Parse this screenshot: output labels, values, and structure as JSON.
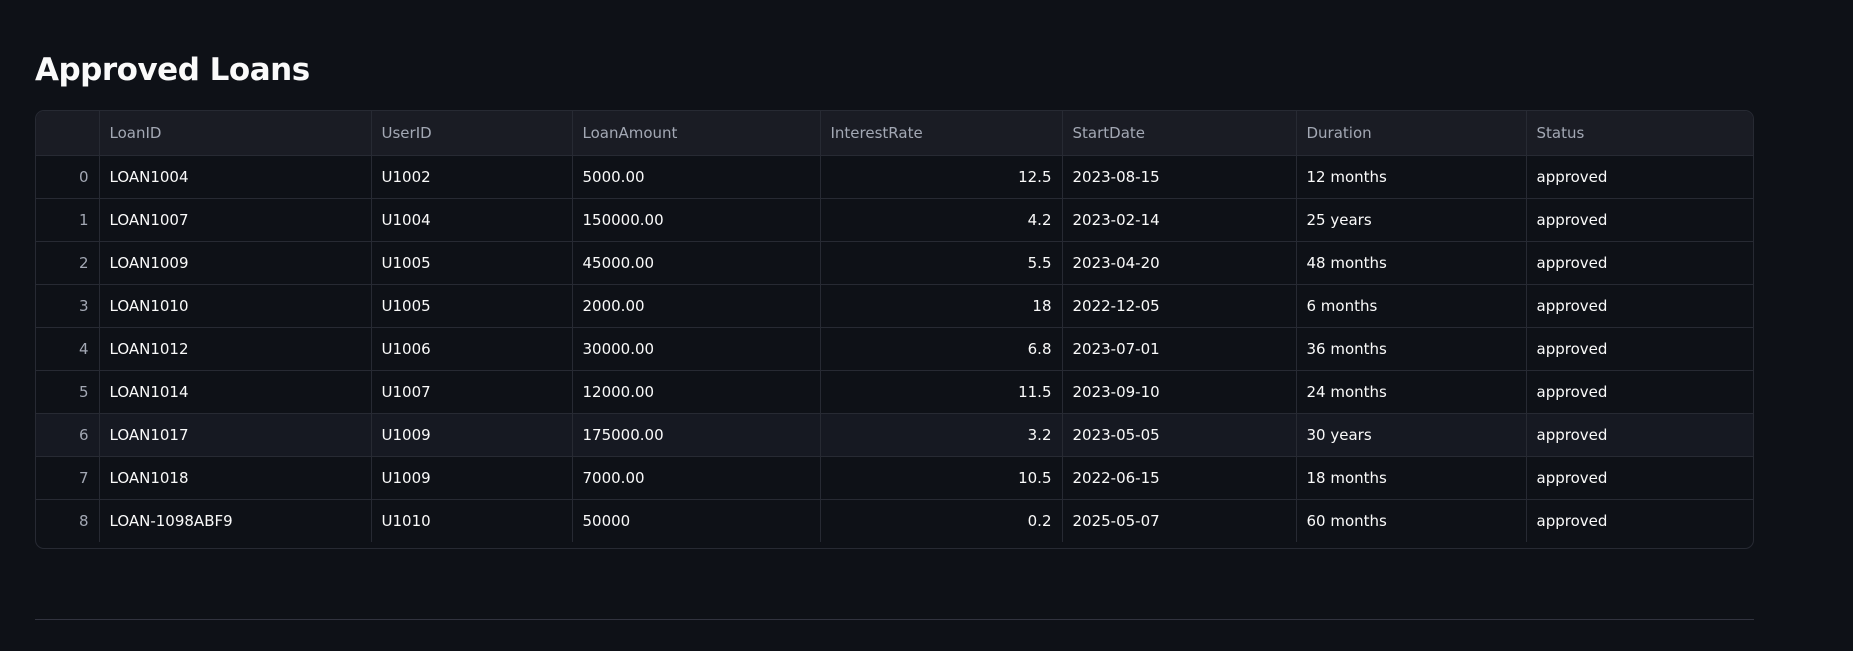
{
  "page": {
    "title": "Approved Loans"
  },
  "table": {
    "columns": [
      "",
      "LoanID",
      "UserID",
      "LoanAmount",
      "InterestRate",
      "StartDate",
      "Duration",
      "Status"
    ],
    "rows": [
      [
        "0",
        "LOAN1004",
        "U1002",
        "5000.00",
        "12.5",
        "2023-08-15",
        "12 months",
        "approved"
      ],
      [
        "1",
        "LOAN1007",
        "U1004",
        "150000.00",
        "4.2",
        "2023-02-14",
        "25 years",
        "approved"
      ],
      [
        "2",
        "LOAN1009",
        "U1005",
        "45000.00",
        "5.5",
        "2023-04-20",
        "48 months",
        "approved"
      ],
      [
        "3",
        "LOAN1010",
        "U1005",
        "2000.00",
        "18",
        "2022-12-05",
        "6 months",
        "approved"
      ],
      [
        "4",
        "LOAN1012",
        "U1006",
        "30000.00",
        "6.8",
        "2023-07-01",
        "36 months",
        "approved"
      ],
      [
        "5",
        "LOAN1014",
        "U1007",
        "12000.00",
        "11.5",
        "2023-09-10",
        "24 months",
        "approved"
      ],
      [
        "6",
        "LOAN1017",
        "U1009",
        "175000.00",
        "3.2",
        "2023-05-05",
        "30 years",
        "approved"
      ],
      [
        "7",
        "LOAN1018",
        "U1009",
        "7000.00",
        "10.5",
        "2022-06-15",
        "18 months",
        "approved"
      ],
      [
        "8",
        "LOAN-1098ABF9",
        "U1010",
        "50000",
        "0.2",
        "2025-05-07",
        "60 months",
        "approved"
      ]
    ],
    "hovered_row": 6
  },
  "colors": {
    "background": "#0e1117",
    "header_bg": "#1a1c24",
    "border": "#272a33",
    "text": "#fafafa",
    "muted_text": "#a3a8b4"
  }
}
